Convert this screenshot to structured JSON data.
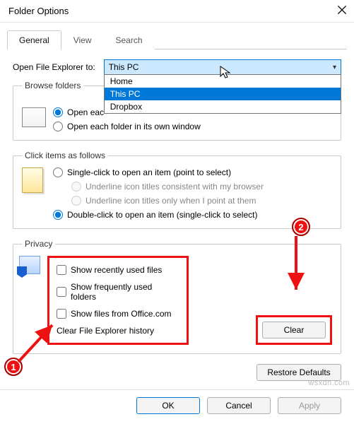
{
  "window": {
    "title": "Folder Options"
  },
  "tabs": {
    "general": "General",
    "view": "View",
    "search": "Search"
  },
  "openExplorer": {
    "label": "Open File Explorer to:",
    "selected": "This PC",
    "options": [
      "Home",
      "This PC",
      "Dropbox"
    ]
  },
  "browseFolders": {
    "legend": "Browse folders",
    "opt1": "Open eac",
    "opt2": "Open each folder in its own window"
  },
  "clickItems": {
    "legend": "Click items as follows",
    "single": "Single-click to open an item (point to select)",
    "underlineBrowser": "Underline icon titles consistent with my browser",
    "underlinePoint": "Underline icon titles only when I point at them",
    "double": "Double-click to open an item (single-click to select)"
  },
  "privacy": {
    "legend": "Privacy",
    "showRecent": "Show recently used files",
    "showFrequent": "Show frequently used folders",
    "showOffice": "Show files from Office.com",
    "clearHistory": "Clear File Explorer history",
    "clearBtn": "Clear"
  },
  "buttons": {
    "restoreDefaults": "Restore Defaults",
    "ok": "OK",
    "cancel": "Cancel",
    "apply": "Apply"
  },
  "annotations": {
    "m1": "1",
    "m2": "2"
  },
  "watermark": "wsxdn.com"
}
